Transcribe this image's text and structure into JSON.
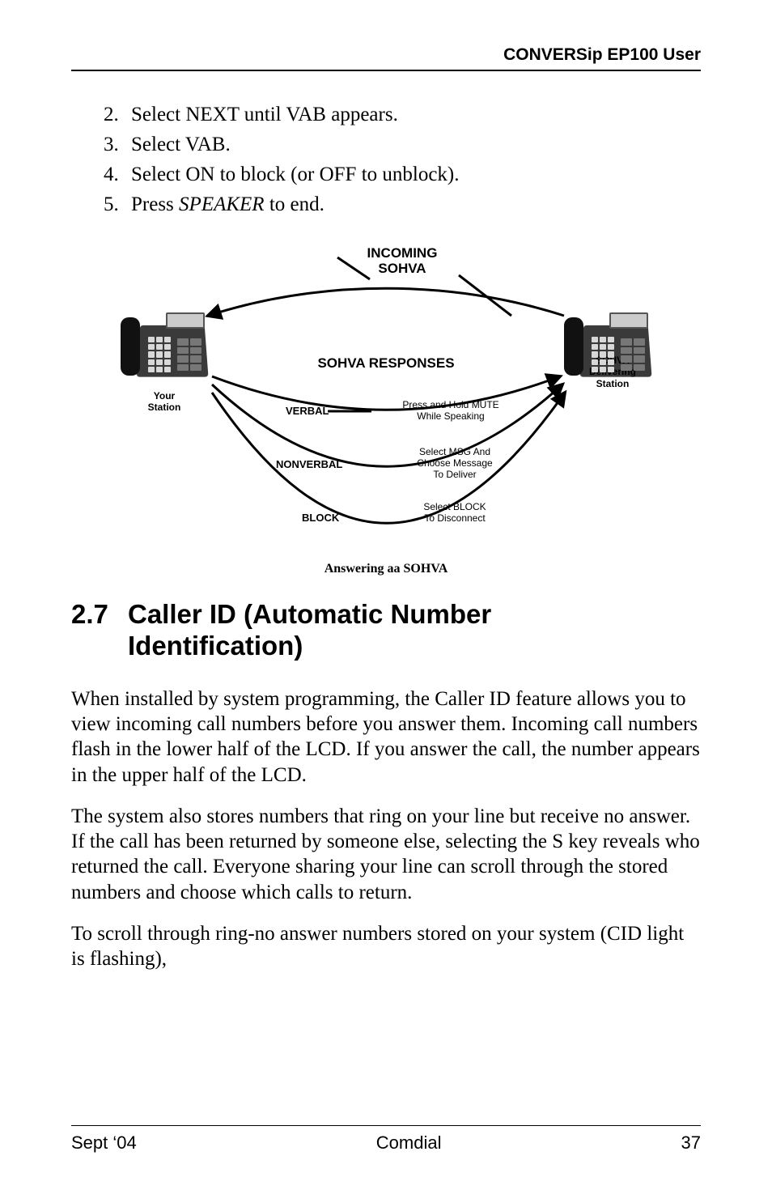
{
  "header": {
    "title": "CONVERSip EP100 User"
  },
  "list": {
    "items": [
      {
        "n": "2.",
        "text": "Select NEXT until VAB appears."
      },
      {
        "n": "3.",
        "text": "Select VAB."
      },
      {
        "n": "4.",
        "text": "Select ON to block (or OFF to unblock)."
      },
      {
        "n": "5.",
        "text_prefix": "Press ",
        "key": "SPEAKER",
        "text_suffix": " to end."
      }
    ]
  },
  "diagram": {
    "incoming_line1": "INCOMING",
    "incoming_line2": "SOHVA",
    "responses_label": "SOHVA RESPONSES",
    "your_station_line1": "Your",
    "your_station_line2": "Station",
    "deliver_line1": "SOHVA",
    "deliver_line2": "Delivering",
    "deliver_line3": "Station",
    "verbal_label": "VERBAL",
    "verbal_desc_line1": "Press and Hold MUTE",
    "verbal_desc_line2": "While Speaking",
    "nonverbal_label": "NONVERBAL",
    "nonverbal_desc_line1": "Select MSG And",
    "nonverbal_desc_line2": "Choose Message",
    "nonverbal_desc_line3": "To Deliver",
    "block_label": "BLOCK",
    "block_desc_line1": "Select BLOCK",
    "block_desc_line2": "To Disconnect",
    "caption": "Answering aa SOHVA"
  },
  "section": {
    "number": "2.7",
    "title_line1": "Caller ID (Automatic Number",
    "title_line2": "Identification)"
  },
  "paras": {
    "p1": "When installed by system programming, the Caller ID feature allows you to view incoming call numbers before you answer them. Incoming call numbers flash in the lower half of the LCD. If you answer the call, the number appears in the upper half of the LCD.",
    "p2": "The system also stores numbers that ring on your line but receive no answer. If the call has been returned by someone else, selecting the  S key reveals who returned the call. Everyone sharing your line can scroll through the stored numbers and choose which calls to return.",
    "p3": "To scroll through ring-no answer numbers stored on your system (CID light is flashing),"
  },
  "footer": {
    "left": "Sept ‘04",
    "center": "Comdial",
    "right": "37"
  }
}
